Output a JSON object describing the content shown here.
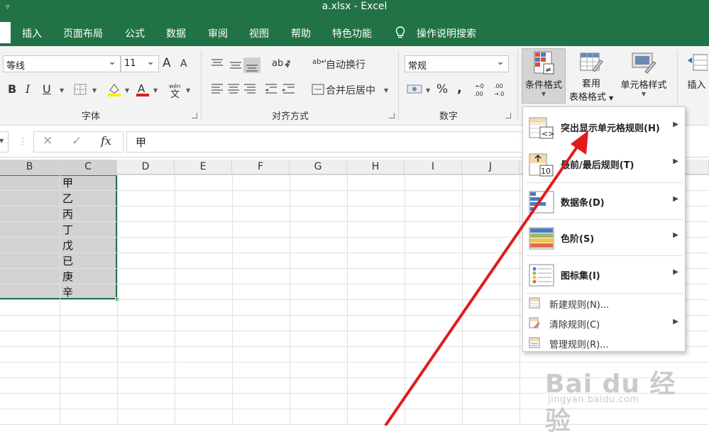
{
  "window": {
    "title": "a.xlsx  -  Excel"
  },
  "tabs": [
    {
      "label": "插入"
    },
    {
      "label": "页面布局"
    },
    {
      "label": "公式"
    },
    {
      "label": "数据"
    },
    {
      "label": "审阅"
    },
    {
      "label": "视图"
    },
    {
      "label": "帮助"
    },
    {
      "label": "特色功能"
    }
  ],
  "tell_me": "操作说明搜索",
  "ribbon": {
    "font": {
      "name": "等线",
      "size": "11",
      "group_label": "字体",
      "bold": "B",
      "italic": "I",
      "underline": "U",
      "grow": "A",
      "shrink": "A"
    },
    "alignment": {
      "wrap_text": "自动换行",
      "merge_center": "合并后居中",
      "group_label": "对齐方式"
    },
    "number": {
      "format": "常规",
      "percent": "%",
      "comma": ",",
      "group_label": "数字"
    },
    "styles": {
      "conditional_format": "条件格式",
      "table_format_line1": "套用",
      "table_format_line2": "表格格式",
      "cell_styles": "单元格样式"
    },
    "cells": {
      "insert": "插入"
    }
  },
  "formula_bar": {
    "cancel": "✕",
    "enter": "✓",
    "fx": "fx",
    "value": "甲"
  },
  "columns": [
    "B",
    "C",
    "D",
    "E",
    "F",
    "G",
    "H",
    "I",
    "J"
  ],
  "cells": [
    "甲",
    "乙",
    "丙",
    "丁",
    "戊",
    "已",
    "庚",
    "辛"
  ],
  "cf_menu": {
    "big_items": [
      {
        "label": "突出显示单元格规则(H)"
      },
      {
        "label": "最前/最后规则(T)"
      },
      {
        "label": "数据条(D)"
      },
      {
        "label": "色阶(S)"
      },
      {
        "label": "图标集(I)"
      }
    ],
    "small_items": [
      {
        "label": "新建规则(N)...",
        "has_submenu": false
      },
      {
        "label": "清除规则(C)",
        "has_submenu": true
      },
      {
        "label": "管理规则(R)..."
      }
    ],
    "icon_text_10": "10"
  },
  "watermark": {
    "brand": "Bai du 经验",
    "url": "jingyan.baidu.com"
  },
  "colors": {
    "excel_green": "#217346",
    "annotation_arrow": "#e21b1b"
  }
}
